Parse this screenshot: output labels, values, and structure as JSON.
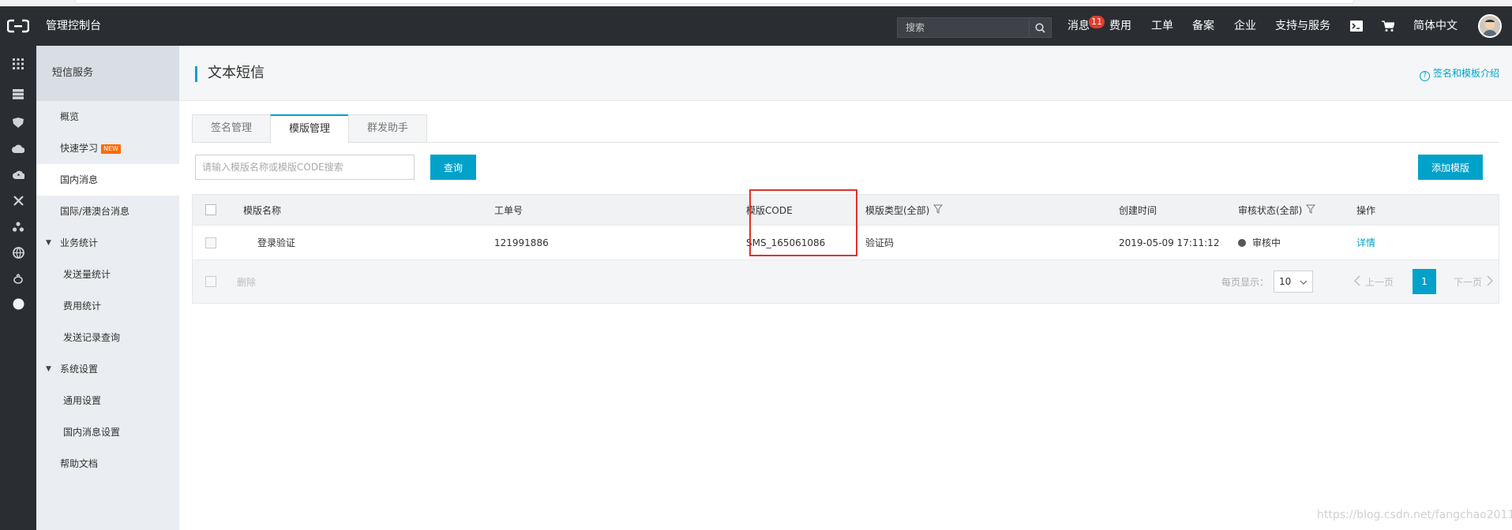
{
  "topbar": {
    "console_title": "管理控制台",
    "search_placeholder": "搜索",
    "nav": {
      "messages": "消息",
      "messages_badge": "11",
      "fees": "费用",
      "tickets": "工单",
      "icp": "备案",
      "enterprise": "企业",
      "support": "支持与服务",
      "language": "简体中文"
    }
  },
  "sidebar": {
    "header": "短信服务",
    "items": [
      {
        "label": "概览"
      },
      {
        "label": "快速学习",
        "tag": "NEW"
      },
      {
        "label": "国内消息"
      },
      {
        "label": "国际/港澳台消息"
      },
      {
        "label": "业务统计"
      },
      {
        "label": "发送量统计"
      },
      {
        "label": "费用统计"
      },
      {
        "label": "发送记录查询"
      },
      {
        "label": "系统设置"
      },
      {
        "label": "通用设置"
      },
      {
        "label": "国内消息设置"
      },
      {
        "label": "帮助文档"
      }
    ]
  },
  "page": {
    "title": "文本短信",
    "help_link": "签名和模板介绍"
  },
  "tabs": [
    {
      "label": "签名管理"
    },
    {
      "label": "模版管理"
    },
    {
      "label": "群发助手"
    }
  ],
  "toolbar": {
    "search_placeholder": "请输入模版名称或模版CODE搜索",
    "query_label": "查询",
    "add_label": "添加模版"
  },
  "table": {
    "columns": [
      "模版名称",
      "工单号",
      "模版CODE",
      "模版类型(全部)",
      "创建时间",
      "审核状态(全部)",
      "操作"
    ],
    "rows": [
      {
        "name": "登录验证",
        "ticket": "121991886",
        "code": "SMS_165061086",
        "type": "验证码",
        "created": "2019-05-09 17:11:12",
        "status": "审核中",
        "action": "详情"
      }
    ],
    "footer": {
      "delete_label": "删除",
      "page_size_label": "每页显示：",
      "page_size": "10",
      "prev_label": "上一页",
      "current_page": "1",
      "next_label": "下一页"
    }
  },
  "colors": {
    "accent": "#00a2ca",
    "topbar": "#2a2e33",
    "badge": "#e33c2e",
    "highlight": "#e2302b"
  },
  "watermark": "https://blog.csdn.net/fangchao2011"
}
